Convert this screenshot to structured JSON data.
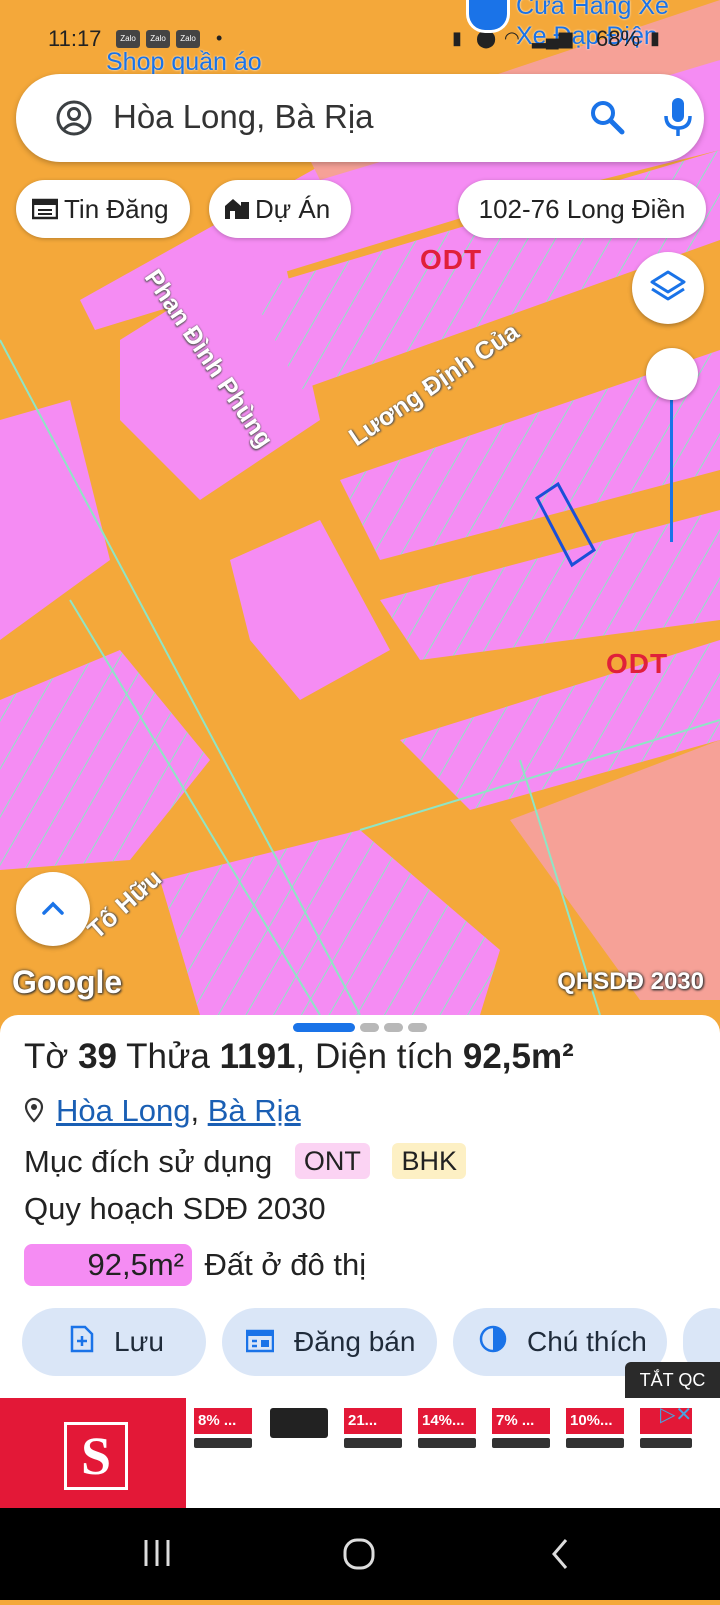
{
  "status": {
    "time": "11:17",
    "battery": "68%",
    "zalo": "Zalo"
  },
  "search": {
    "text": "Hòa Long, Bà Rịa"
  },
  "chips": [
    {
      "label": "Tin Đăng",
      "icon": "listing-icon"
    },
    {
      "label": "Dự Án",
      "icon": "buildings-icon"
    },
    {
      "label": "102-76 Long Điền",
      "icon": ""
    }
  ],
  "map": {
    "roads": [
      "Phan Đình Phùng",
      "Lương Định Của",
      "Tố Hữu"
    ],
    "zones": [
      "ODT",
      "ODT"
    ],
    "top_labels": [
      "Shop quần áo",
      "Cửa Hàng Xe",
      "Xe Đạp Điện"
    ],
    "attribution": "Google",
    "layer_name": "QHSDĐ 2030",
    "colors": {
      "road": "#f4a83a",
      "residential": "#f58cf3",
      "other": "#f6a197",
      "parcel_line": "#8fe5c5",
      "selected": "#1a73e8"
    }
  },
  "sheet": {
    "sheet_word": "Tờ",
    "sheet_no": "39",
    "parcel_word": "Thửa",
    "parcel_no": "1191",
    "area_word": "Diện tích",
    "area": "92,5m²",
    "location": {
      "ward": "Hòa Long",
      "city": "Bà Rịa"
    },
    "purpose_label": "Mục đích sử dụng",
    "purpose_tags": [
      {
        "label": "ONT",
        "color": "#fbd3f3"
      },
      {
        "label": "BHK",
        "color": "#fdf0c4"
      }
    ],
    "plan_label": "Quy hoạch SDĐ 2030",
    "plan_area": "92,5m²",
    "plan_desc": "Đất ở đô thị",
    "actions": [
      {
        "label": "Lưu",
        "icon": "save-icon"
      },
      {
        "label": "Đăng bán",
        "icon": "post-icon"
      },
      {
        "label": "Chú thích",
        "icon": "legend-icon"
      }
    ]
  },
  "ad": {
    "close_label": "TẮT QC",
    "items": [
      "8% ...",
      "21...",
      "14%...",
      "7% ...",
      "10%..."
    ]
  }
}
